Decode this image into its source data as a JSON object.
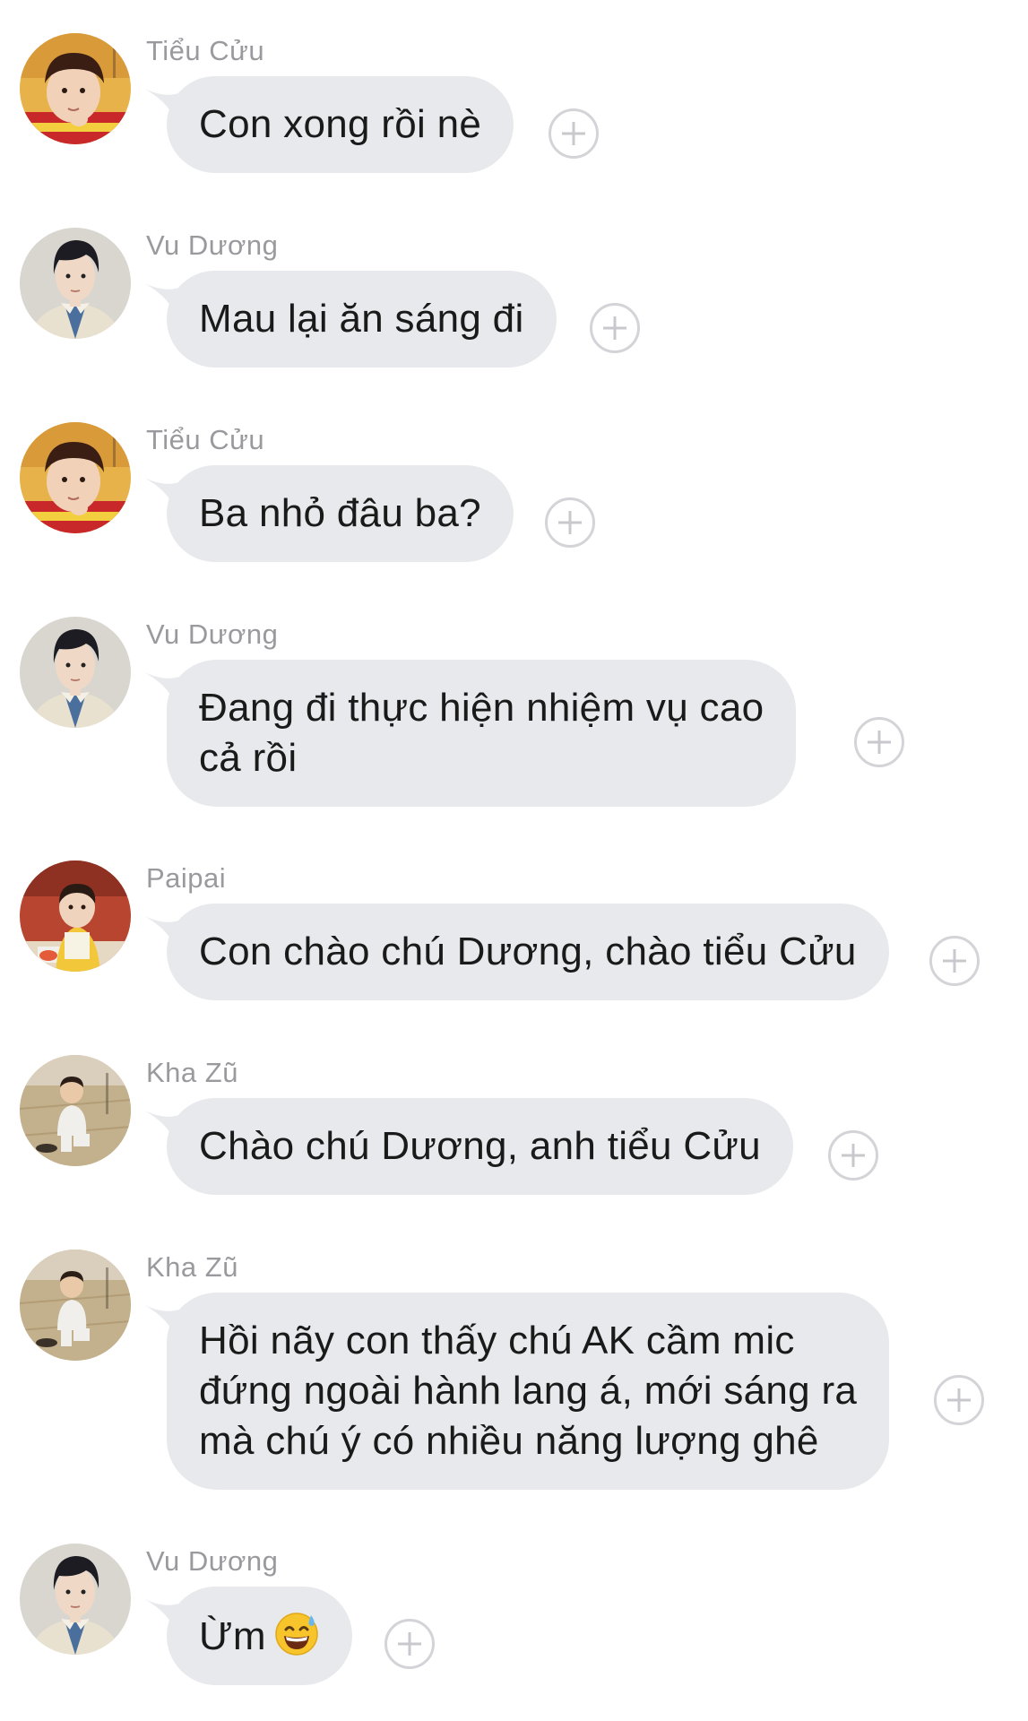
{
  "messages": [
    {
      "sender": "Tiểu Cửu",
      "avatar": "child-avatar-red-yellow-shirt",
      "text": "Con xong rồi nè"
    },
    {
      "sender": "Vu Dương",
      "avatar": "young-man-avatar-beige-jacket",
      "text": "Mau lại ăn sáng đi"
    },
    {
      "sender": "Tiểu Cửu",
      "avatar": "child-avatar-red-yellow-shirt",
      "text": "Ba nhỏ đâu ba?"
    },
    {
      "sender": "Vu Dương",
      "avatar": "young-man-avatar-beige-jacket",
      "text": "Đang đi thực hiện nhiệm vụ cao\ncả rồi"
    },
    {
      "sender": "Paipai",
      "avatar": "child-avatar-yellow-bib",
      "text": "Con chào chú Dương, chào tiểu Cửu"
    },
    {
      "sender": "Kha Zũ",
      "avatar": "toddler-avatar-outdoor-pavement",
      "text": "Chào chú Dương, anh tiểu Cửu"
    },
    {
      "sender": "Kha Zũ",
      "avatar": "toddler-avatar-outdoor-pavement",
      "text": "Hồi nãy con thấy chú AK cầm mic\nđứng ngoài hành lang á, mới sáng ra\nmà chú ý có nhiều năng lượng ghê"
    },
    {
      "sender": "Vu Dương",
      "avatar": "young-man-avatar-beige-jacket",
      "text": "Ừm",
      "emoji": "grinning-sweat-emoji"
    }
  ],
  "colors": {
    "bubble": "#e8e9ec",
    "sender_name": "#9a9a9e",
    "text": "#1a1a1a",
    "plus_icon": "#d4d4d8"
  }
}
